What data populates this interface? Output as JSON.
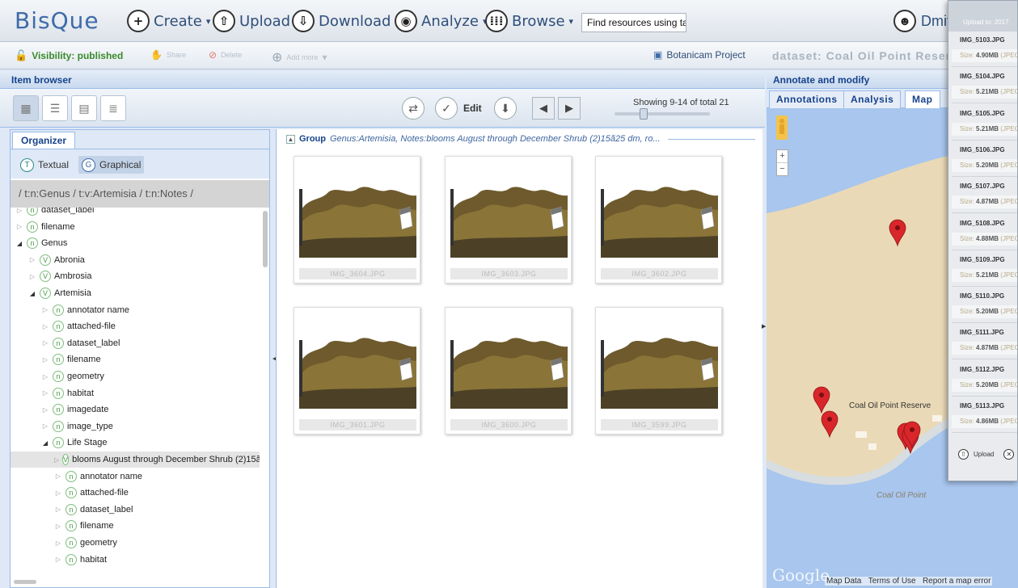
{
  "app": {
    "logo": "BisQue"
  },
  "topnav": {
    "create": "Create",
    "upload": "Upload",
    "download": "Download",
    "analyze": "Analyze",
    "browse": "Browse",
    "search_value": "Find resources using ta",
    "user": "Dmit"
  },
  "subbar": {
    "visibility": "Visibility: published",
    "share": "Share",
    "delete": "Delete",
    "add_more": "Add more",
    "project": "Botanicam Project",
    "dataset": "dataset: Coal Oil Point Reser"
  },
  "item_browser": {
    "title": "Item browser",
    "edit_label": "Edit",
    "showing": "Showing 9-14 of total 21",
    "page_progress": 0.29
  },
  "organizer": {
    "tab": "Organizer",
    "textual": "Textual",
    "graphical": "Graphical",
    "breadcrumb": "/ t:n:Genus / t:v:Artemisia / t:n:Notes /",
    "tree": [
      {
        "label": "dataset_label",
        "type": "n",
        "depth": 0,
        "expanded": false
      },
      {
        "label": "filename",
        "type": "n",
        "depth": 0,
        "expanded": false
      },
      {
        "label": "Genus",
        "type": "n",
        "depth": 0,
        "expanded": true
      },
      {
        "label": "Abronia",
        "type": "V",
        "depth": 1,
        "expanded": false
      },
      {
        "label": "Ambrosia",
        "type": "V",
        "depth": 1,
        "expanded": false
      },
      {
        "label": "Artemisia",
        "type": "V",
        "depth": 1,
        "expanded": true
      },
      {
        "label": "annotator name",
        "type": "n",
        "depth": 2,
        "expanded": false
      },
      {
        "label": "attached-file",
        "type": "n",
        "depth": 2,
        "expanded": false
      },
      {
        "label": "dataset_label",
        "type": "n",
        "depth": 2,
        "expanded": false
      },
      {
        "label": "filename",
        "type": "n",
        "depth": 2,
        "expanded": false
      },
      {
        "label": "geometry",
        "type": "n",
        "depth": 2,
        "expanded": false
      },
      {
        "label": "habitat",
        "type": "n",
        "depth": 2,
        "expanded": false
      },
      {
        "label": "imagedate",
        "type": "n",
        "depth": 2,
        "expanded": false
      },
      {
        "label": "image_type",
        "type": "n",
        "depth": 2,
        "expanded": false
      },
      {
        "label": "Life Stage",
        "type": "n",
        "depth": 2,
        "expanded": true
      },
      {
        "label": "blooms August through December Shrub (2)15ã",
        "type": "V",
        "depth": 3,
        "expanded": false,
        "selected": true
      },
      {
        "label": "annotator name",
        "type": "n",
        "depth": 3,
        "expanded": false
      },
      {
        "label": "attached-file",
        "type": "n",
        "depth": 3,
        "expanded": false
      },
      {
        "label": "dataset_label",
        "type": "n",
        "depth": 3,
        "expanded": false
      },
      {
        "label": "filename",
        "type": "n",
        "depth": 3,
        "expanded": false
      },
      {
        "label": "geometry",
        "type": "n",
        "depth": 3,
        "expanded": false
      },
      {
        "label": "habitat",
        "type": "n",
        "depth": 3,
        "expanded": false
      }
    ]
  },
  "gallery": {
    "group_prefix": "Group",
    "group_label": "Genus:Artemisia, Notes:blooms August through December Shrub (2)15ã25 dm, ro...",
    "thumbnails": [
      {
        "caption": "IMG_3604.JPG"
      },
      {
        "caption": "IMG_3603.JPG"
      },
      {
        "caption": "IMG_3602.JPG"
      },
      {
        "caption": "IMG_3601.JPG"
      },
      {
        "caption": "IMG_3600.JPG"
      },
      {
        "caption": "IMG_3599.JPG"
      }
    ]
  },
  "annotate": {
    "title": "Annotate and modify",
    "tabs": [
      "Annotations",
      "Analysis",
      "Map"
    ],
    "active_tab": "Map"
  },
  "map": {
    "place_label": "Coal Oil Point Reserve",
    "point_label": "Coal Oil Point",
    "google": "Google",
    "map_data": "Map Data",
    "terms": "Terms of Use",
    "report": "Report a map error"
  },
  "upload_panel": {
    "header": "Upload to:  2017",
    "files": [
      {
        "name": "IMG_5103.JPG",
        "size": "4.90MB",
        "kind": "JPEG"
      },
      {
        "name": "IMG_5104.JPG",
        "size": "5.21MB",
        "kind": "JPEG"
      },
      {
        "name": "IMG_5105.JPG",
        "size": "5.21MB",
        "kind": "JPEG"
      },
      {
        "name": "IMG_5106.JPG",
        "size": "5.20MB",
        "kind": "JPEG"
      },
      {
        "name": "IMG_5107.JPG",
        "size": "4.87MB",
        "kind": "JPEG"
      },
      {
        "name": "IMG_5108.JPG",
        "size": "4.88MB",
        "kind": "JPEG"
      },
      {
        "name": "IMG_5109.JPG",
        "size": "5.21MB",
        "kind": "JPEG"
      },
      {
        "name": "IMG_5110.JPG",
        "size": "5.20MB",
        "kind": "JPEG"
      },
      {
        "name": "IMG_5111.JPG",
        "size": "4.87MB",
        "kind": "JPEG"
      },
      {
        "name": "IMG_5112.JPG",
        "size": "5.20MB",
        "kind": "JPEG"
      },
      {
        "name": "IMG_5113.JPG",
        "size": "4.86MB",
        "kind": "JPEG"
      }
    ],
    "size_prefix": "Size:",
    "upload_label": "Upload"
  },
  "colors": {
    "accent": "#15428b",
    "brand": "#3e6ba8",
    "published": "#3a8a2a",
    "marker": "#d9262b",
    "land": "#ead9b6",
    "water": "#a8c6ee"
  }
}
